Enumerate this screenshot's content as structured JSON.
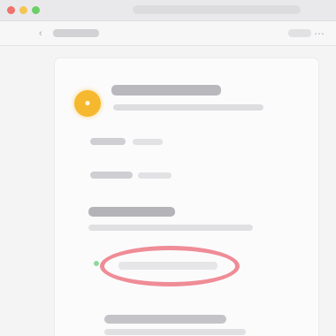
{
  "window": {
    "traffic_colors": [
      "#f0726c",
      "#f4c553",
      "#6ccf68"
    ]
  },
  "toolbar": {
    "back_icon": "chevron-left-icon",
    "title": "",
    "menu_icon": "ellipsis-icon"
  },
  "app": {
    "icon": "app-icon",
    "icon_color": "#f5b82e",
    "name": ""
  },
  "settings": {
    "row1_label": "",
    "row2_label": "",
    "section_title": ""
  },
  "highlight": {
    "color": "#ef8c96",
    "text": ""
  },
  "footer": {
    "title": ""
  }
}
